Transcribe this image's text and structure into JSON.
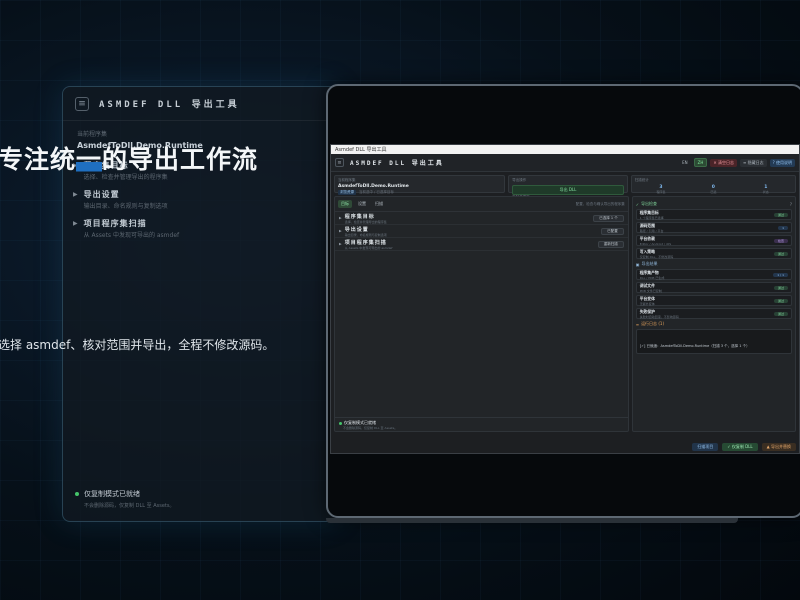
{
  "hero": {
    "headline": "专注统一的导出工作流",
    "headline_highlight": "一",
    "subline": "选择 asmdef、核对范围并导出，全程不修改源码。"
  },
  "ghost_panel": {
    "title": "ASMDEF DLL 导出工具",
    "menu_icon": "≡",
    "section_label": "当前程序集",
    "assembly": "AsmdefToDll.Demo.Runtime",
    "rows": [
      {
        "title": "程序集目标",
        "sub": "选择、检查并管理导出的程序集"
      },
      {
        "title": "导出设置",
        "sub": "输出目录、命名规则与复制选项"
      },
      {
        "title": "项目程序集扫描",
        "sub": "从 Assets 中发现可导出的 asmdef"
      }
    ],
    "footer_title": "仅复制模式已就绪",
    "footer_sub": "不会删除源码，仅复制 DLL 至 Assets。"
  },
  "app": {
    "window_title": "Asmdef DLL 导出工具",
    "menu_icon": "≡",
    "title": "ASMDEF DLL 导出工具",
    "header_buttons": {
      "lang": "ZH",
      "lang_active": "EN",
      "clear": "✕ 清空日志",
      "hide": "≡ 隐藏日志",
      "help": "? 使用说明"
    },
    "top": {
      "assembly_label": "当前程序集",
      "assembly": "AsmdefToDll.Demo.Runtime",
      "browse": "浏览资源",
      "browse_hint": "当前选中 / 已选择目标",
      "export_label": "导出操作",
      "export_button": "导出 DLL",
      "export_hint": "复制并更新",
      "stats_label": "扫描统计",
      "stats": [
        {
          "n": "3",
          "l": "程序集"
        },
        {
          "n": "0",
          "l": "已选"
        },
        {
          "n": "1",
          "l": "状态"
        }
      ]
    },
    "tabs": [
      "目标",
      "设置",
      "扫描"
    ],
    "tab_hint": "配置、检查与确认导出的程序集",
    "rows": [
      {
        "title": "程序集目标",
        "sub": "选择、检查并管理导出的程序集",
        "button": "已选择 1 个"
      },
      {
        "title": "导出设置",
        "sub": "输出目录、命名规则与复制选项",
        "button": "已配置"
      },
      {
        "title": "项目程序集扫描",
        "sub": "从 Assets 中发现可导出的 asmdef",
        "button": "重新扫描"
      }
    ],
    "footer_title": "仅复制模式已就绪",
    "footer_sub": "不会删除源码，仅复制 DLL 至 Assets。",
    "right": {
      "section1": "导出检查",
      "section1_q": "?",
      "cards1": [
        {
          "title": "程序集目标",
          "sub": "1 个程序集已选择",
          "badge": "通过",
          "style": "green"
        },
        {
          "title": "源码范围",
          "sub": "路径 / 引用 / 平台",
          "badge": "1",
          "style": "blue"
        },
        {
          "title": "平台依赖",
          "sub": "Editor / Android / iOS",
          "badge": "检查",
          "style": "purple"
        },
        {
          "title": "写入策略",
          "sub": "仅复制 DLL，不修改源码",
          "badge": "通过",
          "style": "green"
        }
      ],
      "section2": "导出结果",
      "cards2": [
        {
          "title": "程序集产物",
          "sub": "DLL / PDB 已生成",
          "badge": "1 / 1",
          "style": "blue"
        },
        {
          "title": "调试文件",
          "sub": "PDB 文件已复制",
          "badge": "通过",
          "style": "green"
        },
        {
          "title": "平台变体",
          "sub": "无额外变体",
          "badge": "通过",
          "style": "green"
        },
        {
          "title": "失败保护",
          "sub": "失败时自动回滚，不影响源码",
          "badge": "通过",
          "style": "green"
        }
      ],
      "section3": "运行日志 (1)",
      "log": "[✓] 已就绪：AsmdefToDll.Demo.Runtime（扫描 3 个，选择 1 个）"
    },
    "bottom": {
      "scan": "扫描项目",
      "copy": "✓ 仅复制 DLL",
      "export": "▲ 导出并替换"
    }
  }
}
